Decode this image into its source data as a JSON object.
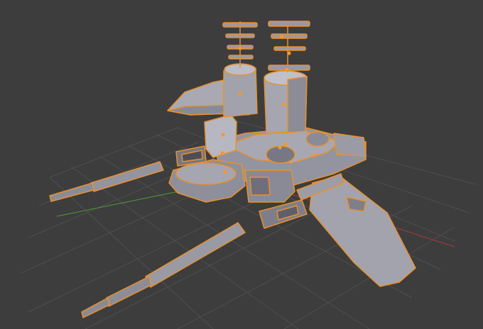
{
  "viewport": {
    "background": "#3d3d3d",
    "grid_color": "#4f4f4f",
    "x_axis_color": "#9b3a3a",
    "y_axis_color": "#4e8a3a"
  },
  "model": {
    "fill": "#9a9aa6",
    "fill_light": "#b4b4bf",
    "fill_dark": "#6f6f7b",
    "selection_outline": "#e8912d",
    "origin_dot": "#f19a2a"
  }
}
